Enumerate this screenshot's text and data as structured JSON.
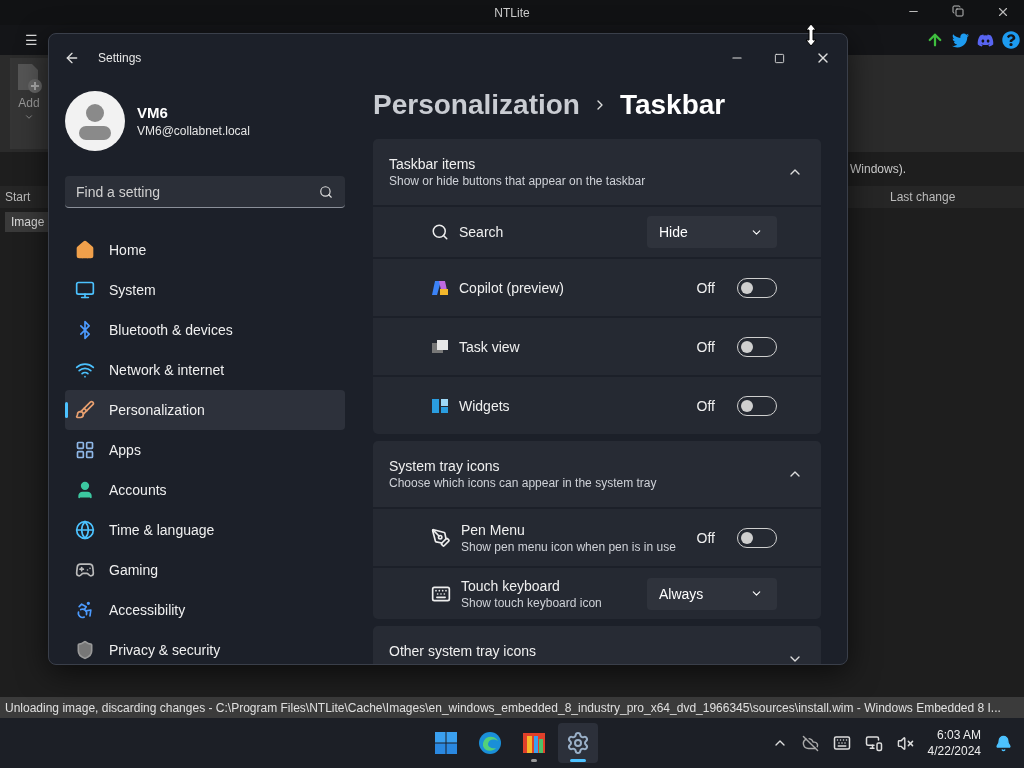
{
  "ntlite": {
    "title": "NTLite",
    "menu_icon": "☰",
    "add_label": "Add",
    "notice": "Windows).",
    "columns": [
      "Start",
      "Last change"
    ],
    "image_tab": "Image"
  },
  "settings": {
    "title": "Settings",
    "user": {
      "name": "VM6",
      "email": "VM6@collabnet.local"
    },
    "search": {
      "placeholder": "Find a setting"
    },
    "nav": [
      {
        "label": "Home",
        "selected": false
      },
      {
        "label": "System",
        "selected": false
      },
      {
        "label": "Bluetooth & devices",
        "selected": false
      },
      {
        "label": "Network & internet",
        "selected": false
      },
      {
        "label": "Personalization",
        "selected": true
      },
      {
        "label": "Apps",
        "selected": false
      },
      {
        "label": "Accounts",
        "selected": false
      },
      {
        "label": "Time & language",
        "selected": false
      },
      {
        "label": "Gaming",
        "selected": false
      },
      {
        "label": "Accessibility",
        "selected": false
      },
      {
        "label": "Privacy & security",
        "selected": false
      }
    ],
    "breadcrumb": {
      "parent": "Personalization",
      "current": "Taskbar"
    },
    "sections": [
      {
        "title": "Taskbar items",
        "subtitle": "Show or hide buttons that appear on the taskbar",
        "expanded": true,
        "rows": [
          {
            "kind": "dropdown",
            "label": "Search",
            "value": "Hide"
          },
          {
            "kind": "toggle",
            "label": "Copilot (preview)",
            "state_text": "Off",
            "on": false
          },
          {
            "kind": "toggle",
            "label": "Task view",
            "state_text": "Off",
            "on": false
          },
          {
            "kind": "toggle",
            "label": "Widgets",
            "state_text": "Off",
            "on": false
          }
        ]
      },
      {
        "title": "System tray icons",
        "subtitle": "Choose which icons can appear in the system tray",
        "expanded": true,
        "rows": [
          {
            "kind": "toggle",
            "label": "Pen Menu",
            "description": "Show pen menu icon when pen is in use",
            "state_text": "Off",
            "on": false
          },
          {
            "kind": "dropdown",
            "label": "Touch keyboard",
            "description": "Show touch keyboard icon",
            "value": "Always"
          }
        ]
      },
      {
        "title": "Other system tray icons",
        "expanded": false
      }
    ]
  },
  "status_bar": {
    "text": "Unloading image, discarding changes - C:\\Program Files\\NTLite\\Cache\\Images\\en_windows_embedded_8_industry_pro_x64_dvd_1966345\\sources\\install.wim - Windows Embedded 8 I..."
  },
  "taskbar": {
    "apps": [
      {
        "running": false,
        "selected": false
      },
      {
        "running": false,
        "selected": false
      },
      {
        "running": true,
        "selected": false
      },
      {
        "running": true,
        "selected": true
      }
    ],
    "time": "6:03 AM",
    "date": "4/22/2024"
  }
}
